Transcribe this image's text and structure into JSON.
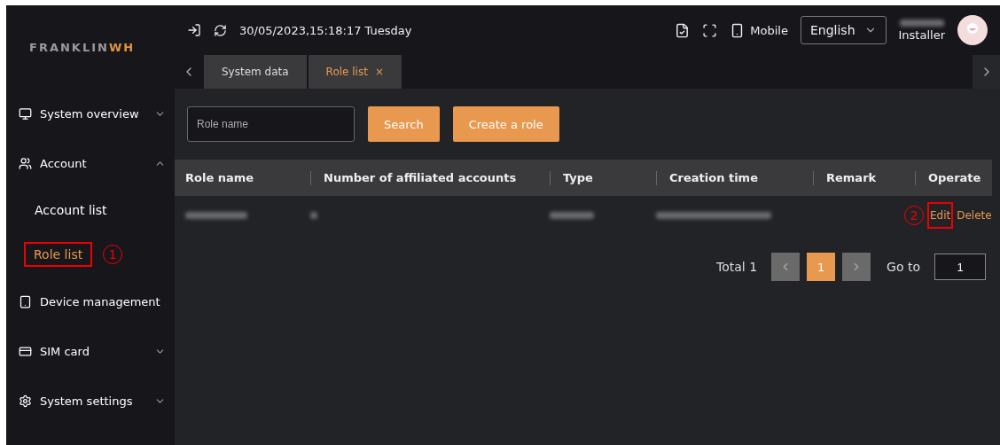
{
  "logo": {
    "main": "FRANKLIN",
    "accent": "WH"
  },
  "top_bar": {
    "datetime": "30/05/2023,15:18:17 Tuesday",
    "mobile_label": "Mobile",
    "language": "English",
    "user_role": "Installer"
  },
  "tabs": [
    {
      "label": "System data",
      "selected": false
    },
    {
      "label": "Role list",
      "selected": true,
      "close": "×"
    }
  ],
  "sidebar": {
    "items": [
      {
        "label": "System overview",
        "expanded": false
      },
      {
        "label": "Account",
        "expanded": true,
        "children": [
          {
            "label": "Account list",
            "selected": false,
            "highlighted": false
          },
          {
            "label": "Role list",
            "selected": true,
            "highlighted": true,
            "marker": "1"
          }
        ]
      },
      {
        "label": "Device management"
      },
      {
        "label": "SIM card",
        "expanded": false
      },
      {
        "label": "System settings",
        "expanded": false
      }
    ]
  },
  "filters": {
    "placeholder": "Role name",
    "buttons": [
      "Search",
      "Create a role"
    ]
  },
  "table": {
    "columns": [
      "Role name",
      "Number of affiliated accounts",
      "Type",
      "Creation time",
      "Remark",
      "Operate"
    ],
    "rows": [
      {
        "cells": [
          {
            "kind": "redacted"
          },
          {
            "kind": "redacted"
          },
          {
            "kind": "redacted"
          },
          {
            "kind": "redacted"
          },
          {
            "kind": "empty"
          }
        ],
        "actions": [
          {
            "label": "Edit",
            "highlighted": true,
            "marker": "2"
          },
          {
            "label": "Delete",
            "highlighted": false
          }
        ]
      }
    ]
  },
  "pagination": {
    "total": "Total 1",
    "pages": [
      {
        "label": "1",
        "selected": true
      }
    ],
    "goto_label": "Go to",
    "goto_value": "1"
  }
}
